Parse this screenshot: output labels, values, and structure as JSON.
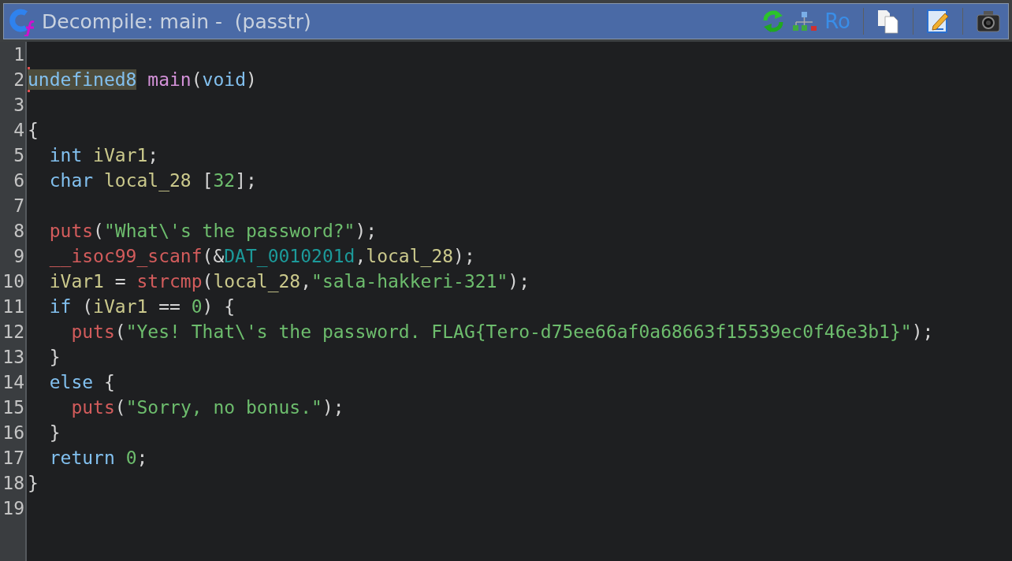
{
  "window": {
    "title": "Decompile: main -  (passtr)"
  },
  "toolbar": {
    "label": "Ro"
  },
  "code": [
    {
      "number": "1",
      "cursor": false
    },
    {
      "number": "2",
      "cursor": true,
      "tokens": [
        {
          "kind": "type",
          "text": "undefined8",
          "highlighted": true
        },
        {
          "kind": "func",
          "text": " main",
          "highlighted": false
        },
        {
          "kind": "plain",
          "text": "(",
          "highlighted": false
        },
        {
          "kind": "type",
          "text": "void",
          "highlighted": false
        },
        {
          "kind": "plain",
          "text": ")",
          "highlighted": false
        }
      ]
    },
    {
      "number": "3",
      "cursor": false
    },
    {
      "number": "4",
      "cursor": false,
      "tokens": [
        {
          "kind": "plain",
          "text": "{",
          "highlighted": false
        }
      ]
    },
    {
      "number": "5",
      "cursor": false,
      "tokens": [
        {
          "kind": "type",
          "text": "  int",
          "highlighted": false
        },
        {
          "kind": "var",
          "text": " iVar1",
          "highlighted": false
        },
        {
          "kind": "plain",
          "text": ";",
          "highlighted": false
        }
      ]
    },
    {
      "number": "6",
      "cursor": false,
      "tokens": [
        {
          "kind": "type",
          "text": "  char",
          "highlighted": false
        },
        {
          "kind": "var",
          "text": " local_28",
          "highlighted": false
        },
        {
          "kind": "plain",
          "text": " [",
          "highlighted": false
        },
        {
          "kind": "num",
          "text": "32",
          "highlighted": false
        },
        {
          "kind": "plain",
          "text": "];",
          "highlighted": false
        }
      ]
    },
    {
      "number": "7",
      "cursor": false
    },
    {
      "number": "8",
      "cursor": false,
      "tokens": [
        {
          "kind": "call",
          "text": "  puts",
          "highlighted": false
        },
        {
          "kind": "plain",
          "text": "(",
          "highlighted": false
        },
        {
          "kind": "str",
          "text": "\"What\\'s the password?\"",
          "highlighted": false
        },
        {
          "kind": "plain",
          "text": ");",
          "highlighted": false
        }
      ]
    },
    {
      "number": "9",
      "cursor": false,
      "tokens": [
        {
          "kind": "call",
          "text": "  __isoc99_scanf",
          "highlighted": false
        },
        {
          "kind": "plain",
          "text": "(&",
          "highlighted": false
        },
        {
          "kind": "global",
          "text": "DAT_0010201d",
          "highlighted": false
        },
        {
          "kind": "plain",
          "text": ",",
          "highlighted": false
        },
        {
          "kind": "var",
          "text": "local_28",
          "highlighted": false
        },
        {
          "kind": "plain",
          "text": ");",
          "highlighted": false
        }
      ]
    },
    {
      "number": "10",
      "cursor": false,
      "tokens": [
        {
          "kind": "var",
          "text": "  iVar1",
          "highlighted": false
        },
        {
          "kind": "plain",
          "text": " = ",
          "highlighted": false
        },
        {
          "kind": "call",
          "text": "strcmp",
          "highlighted": false
        },
        {
          "kind": "plain",
          "text": "(",
          "highlighted": false
        },
        {
          "kind": "var",
          "text": "local_28",
          "highlighted": false
        },
        {
          "kind": "plain",
          "text": ",",
          "highlighted": false
        },
        {
          "kind": "str",
          "text": "\"sala-hakkeri-321\"",
          "highlighted": false
        },
        {
          "kind": "plain",
          "text": ");",
          "highlighted": false
        }
      ]
    },
    {
      "number": "11",
      "cursor": false,
      "tokens": [
        {
          "kind": "type",
          "text": "  if",
          "highlighted": false
        },
        {
          "kind": "plain",
          "text": " (",
          "highlighted": false
        },
        {
          "kind": "var",
          "text": "iVar1",
          "highlighted": false
        },
        {
          "kind": "plain",
          "text": " == ",
          "highlighted": false
        },
        {
          "kind": "num",
          "text": "0",
          "highlighted": false
        },
        {
          "kind": "plain",
          "text": ") {",
          "highlighted": false
        }
      ]
    },
    {
      "number": "12",
      "cursor": false,
      "tokens": [
        {
          "kind": "call",
          "text": "    puts",
          "highlighted": false
        },
        {
          "kind": "plain",
          "text": "(",
          "highlighted": false
        },
        {
          "kind": "str",
          "text": "\"Yes! That\\'s the password. FLAG{Tero-d75ee66af0a68663f15539ec0f46e3b1}\"",
          "highlighted": false
        },
        {
          "kind": "plain",
          "text": ");",
          "highlighted": false
        }
      ]
    },
    {
      "number": "13",
      "cursor": false,
      "tokens": [
        {
          "kind": "plain",
          "text": "  }",
          "highlighted": false
        }
      ]
    },
    {
      "number": "14",
      "cursor": false,
      "tokens": [
        {
          "kind": "type",
          "text": "  else",
          "highlighted": false
        },
        {
          "kind": "plain",
          "text": " {",
          "highlighted": false
        }
      ]
    },
    {
      "number": "15",
      "cursor": false,
      "tokens": [
        {
          "kind": "call",
          "text": "    puts",
          "highlighted": false
        },
        {
          "kind": "plain",
          "text": "(",
          "highlighted": false
        },
        {
          "kind": "str",
          "text": "\"Sorry, no bonus.\"",
          "highlighted": false
        },
        {
          "kind": "plain",
          "text": ");",
          "highlighted": false
        }
      ]
    },
    {
      "number": "16",
      "cursor": false,
      "tokens": [
        {
          "kind": "plain",
          "text": "  }",
          "highlighted": false
        }
      ]
    },
    {
      "number": "17",
      "cursor": false,
      "tokens": [
        {
          "kind": "type",
          "text": "  return",
          "highlighted": false
        },
        {
          "kind": "num",
          "text": " 0",
          "highlighted": false
        },
        {
          "kind": "plain",
          "text": ";",
          "highlighted": false
        }
      ]
    },
    {
      "number": "18",
      "cursor": false,
      "tokens": [
        {
          "kind": "plain",
          "text": "}",
          "highlighted": false
        }
      ]
    },
    {
      "number": "19",
      "cursor": false
    }
  ]
}
